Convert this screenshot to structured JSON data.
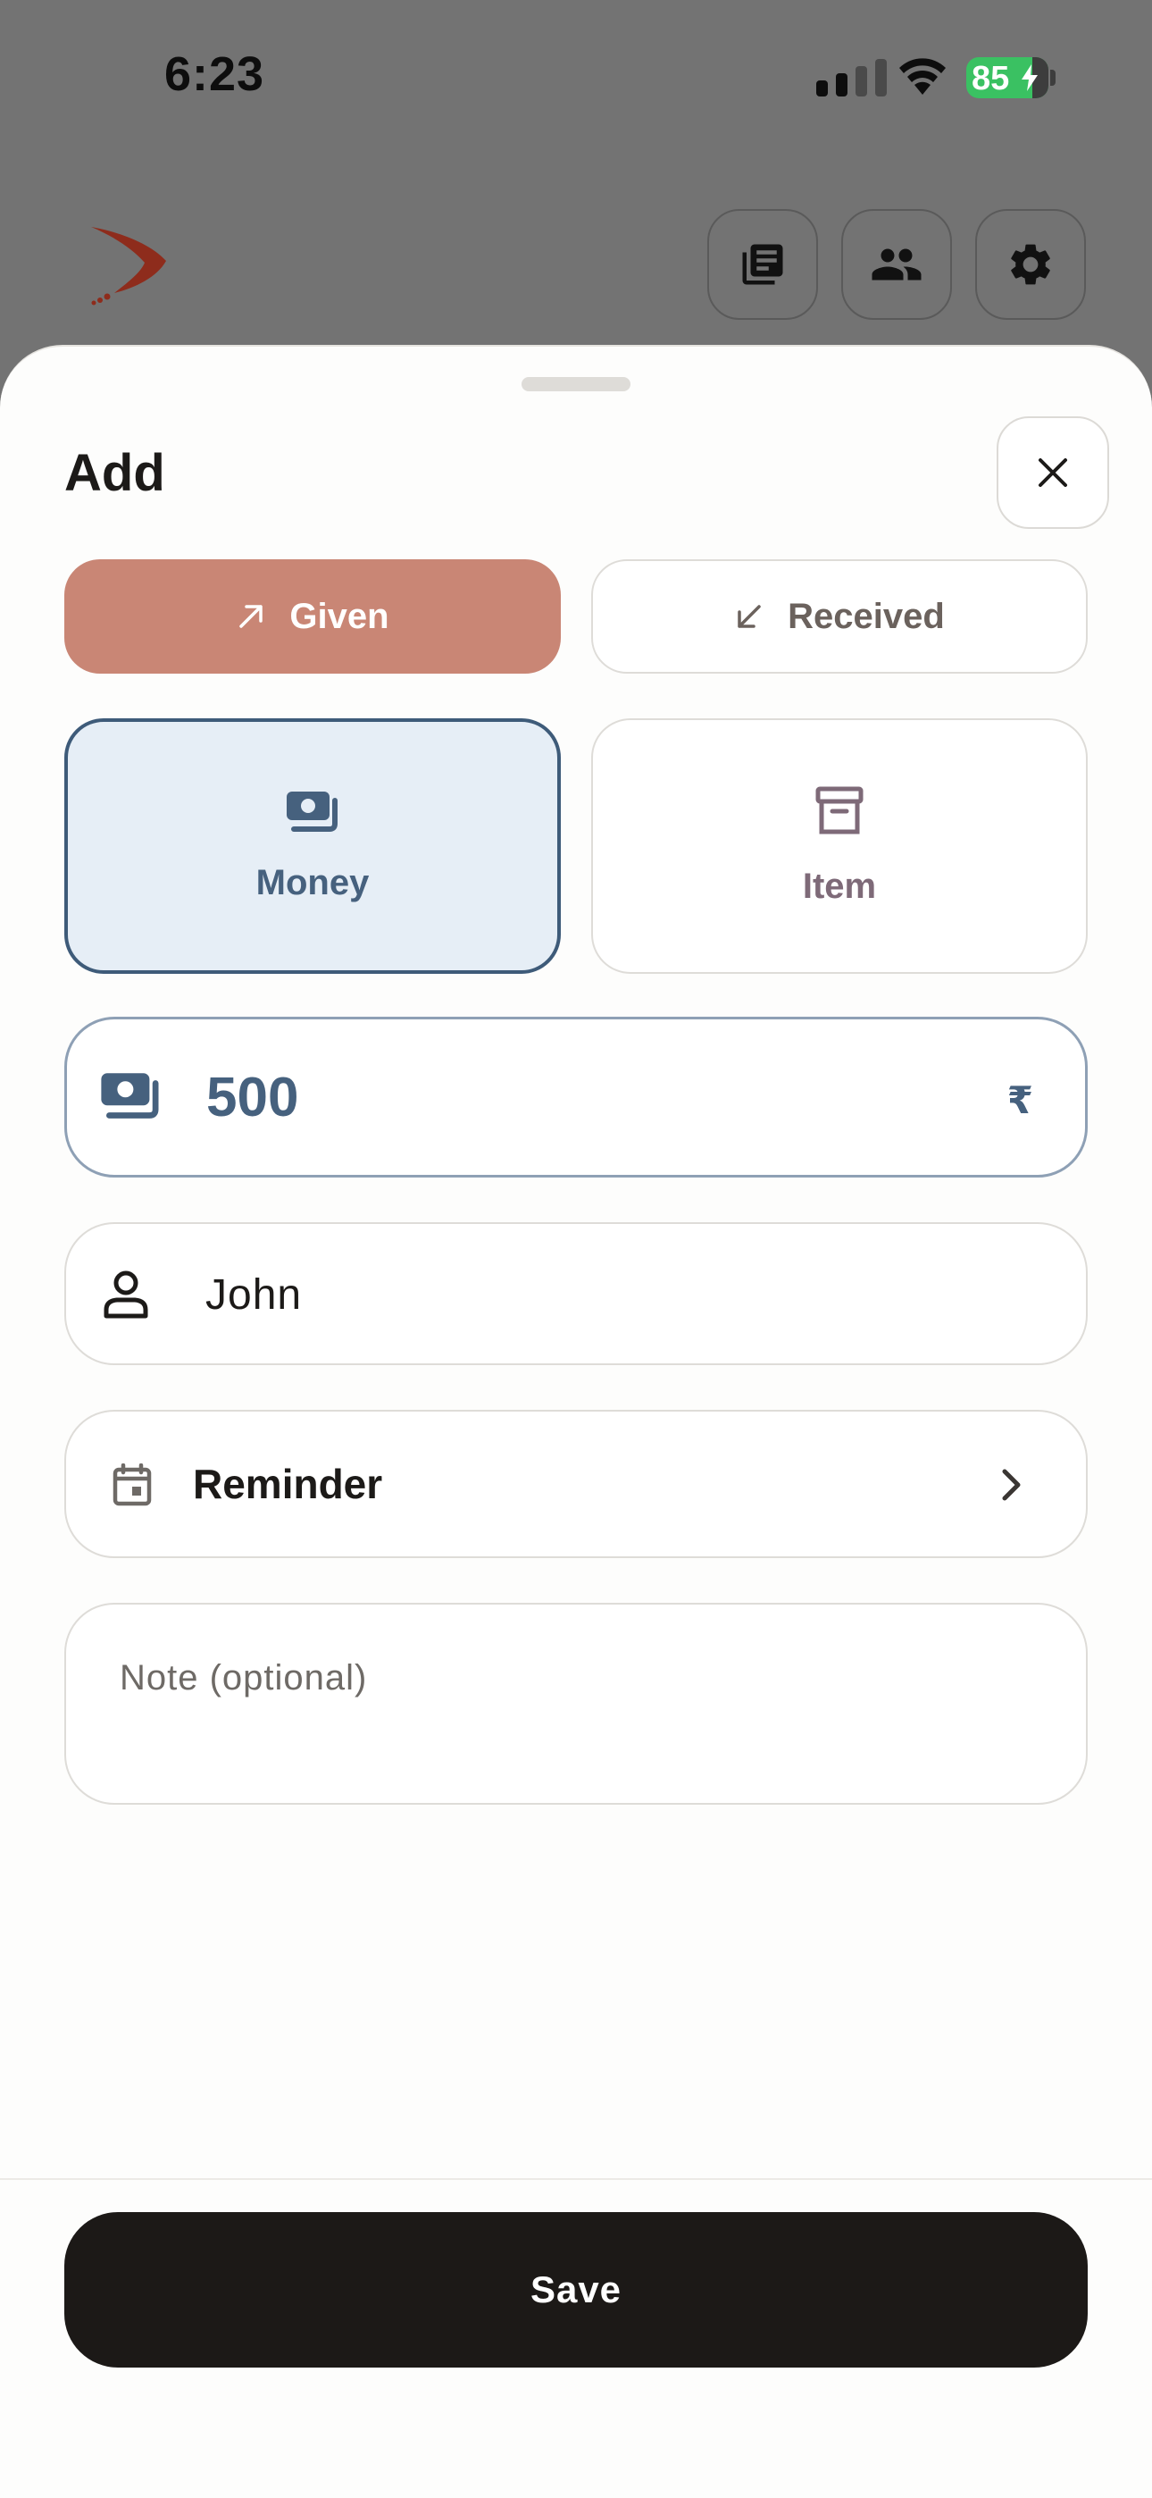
{
  "status_bar": {
    "time": "6:23",
    "battery": "85"
  },
  "header": {
    "logo_icon": "boomerang-logo",
    "buttons": [
      {
        "icon": "library-icon"
      },
      {
        "icon": "people-icon"
      },
      {
        "icon": "gear-icon"
      }
    ]
  },
  "sheet": {
    "title": "Add",
    "close_icon": "close-icon",
    "direction": {
      "given": "Given",
      "received": "Received",
      "selected": "Given",
      "given_color": "#c98675"
    },
    "type": {
      "money": "Money",
      "item": "Item",
      "selected": "Money"
    },
    "amount": {
      "value": "500",
      "currency": "₹"
    },
    "person": {
      "value": "John"
    },
    "reminder": {
      "label": "Reminder"
    },
    "note": {
      "placeholder": "Note (optional)"
    },
    "save_label": "Save"
  }
}
